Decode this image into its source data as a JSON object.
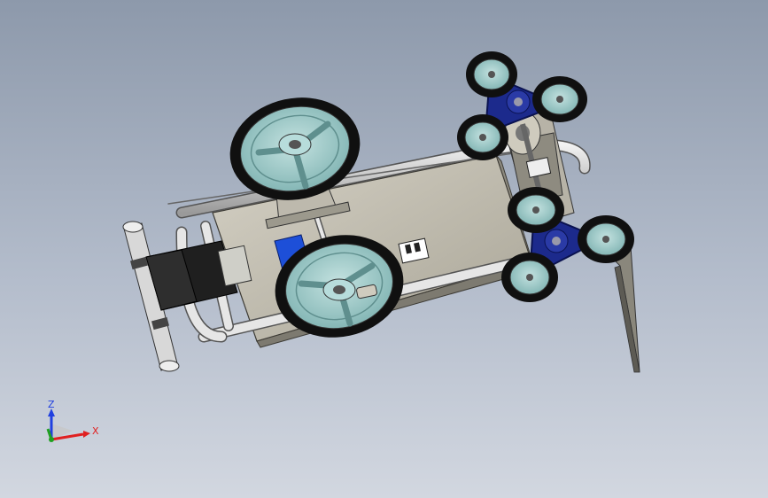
{
  "triad": {
    "x_label": "X",
    "z_label": "Z",
    "colors": {
      "x": "#e02020",
      "y": "#20a020",
      "z": "#2040e0"
    }
  },
  "model": {
    "colors": {
      "tire": "#111111",
      "hub": "#8fc1c0",
      "chassis": "#c2beb1",
      "frame": "#d8d8d8",
      "bracket": "#aaa89c",
      "tri_arm": "#1c2a8c",
      "motor": "#1a1a1a",
      "battery": "#1d4fd8",
      "plate": "#7d7a70"
    }
  }
}
